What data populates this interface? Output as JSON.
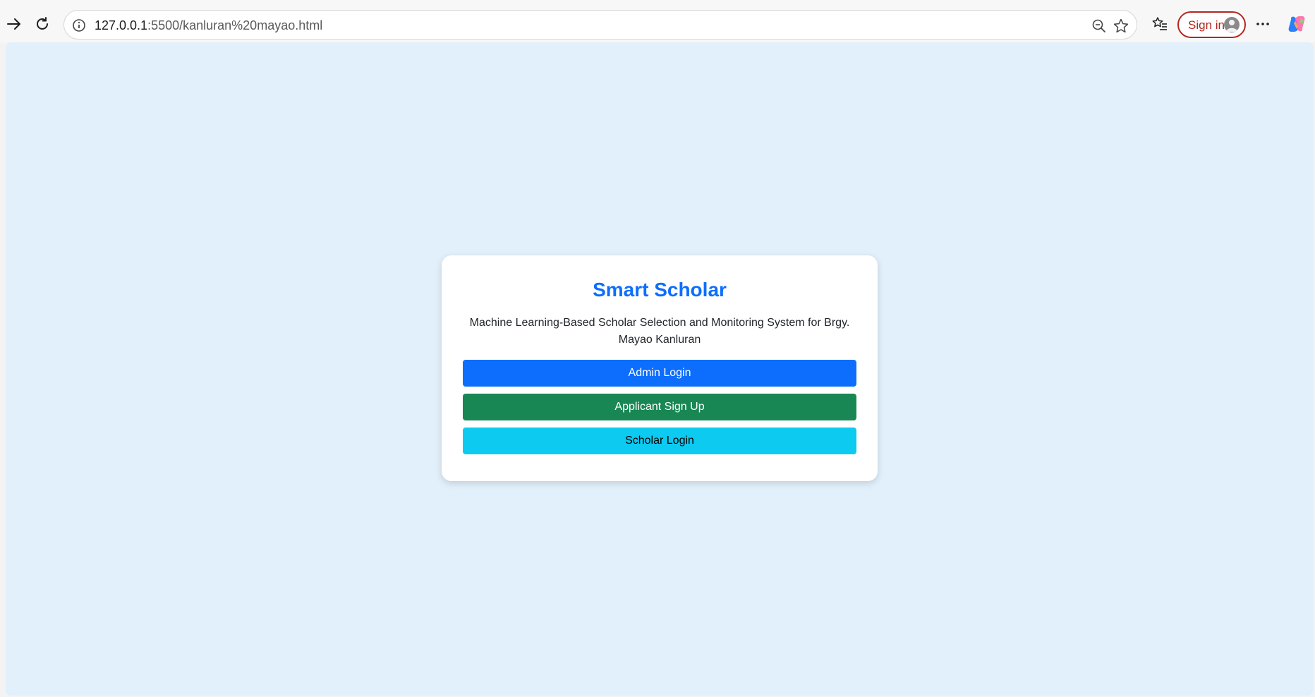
{
  "browser": {
    "url_host": "127.0.0.1",
    "url_path": ":5500/kanluran%20mayao.html",
    "signin_label": "Sign in",
    "icons": {
      "forward": "forward-arrow-icon",
      "refresh": "refresh-icon",
      "info": "info-icon",
      "zoom_out": "zoom-out-icon",
      "favorite": "star-icon",
      "favorites_list": "favorites-icon",
      "more": "more-icon",
      "copilot": "copilot-icon"
    }
  },
  "page": {
    "background": "#e2f0fb",
    "card": {
      "title": "Smart Scholar",
      "description": "Machine Learning-Based Scholar Selection and Monitoring System for Brgy. Mayao Kanluran",
      "buttons": {
        "admin_login": "Admin Login",
        "applicant_signup": "Applicant Sign Up",
        "scholar_login": "Scholar Login"
      },
      "colors": {
        "title": "#0d6efd",
        "admin": "#0d6efd",
        "applicant": "#198754",
        "scholar": "#0dcaf0"
      }
    }
  }
}
